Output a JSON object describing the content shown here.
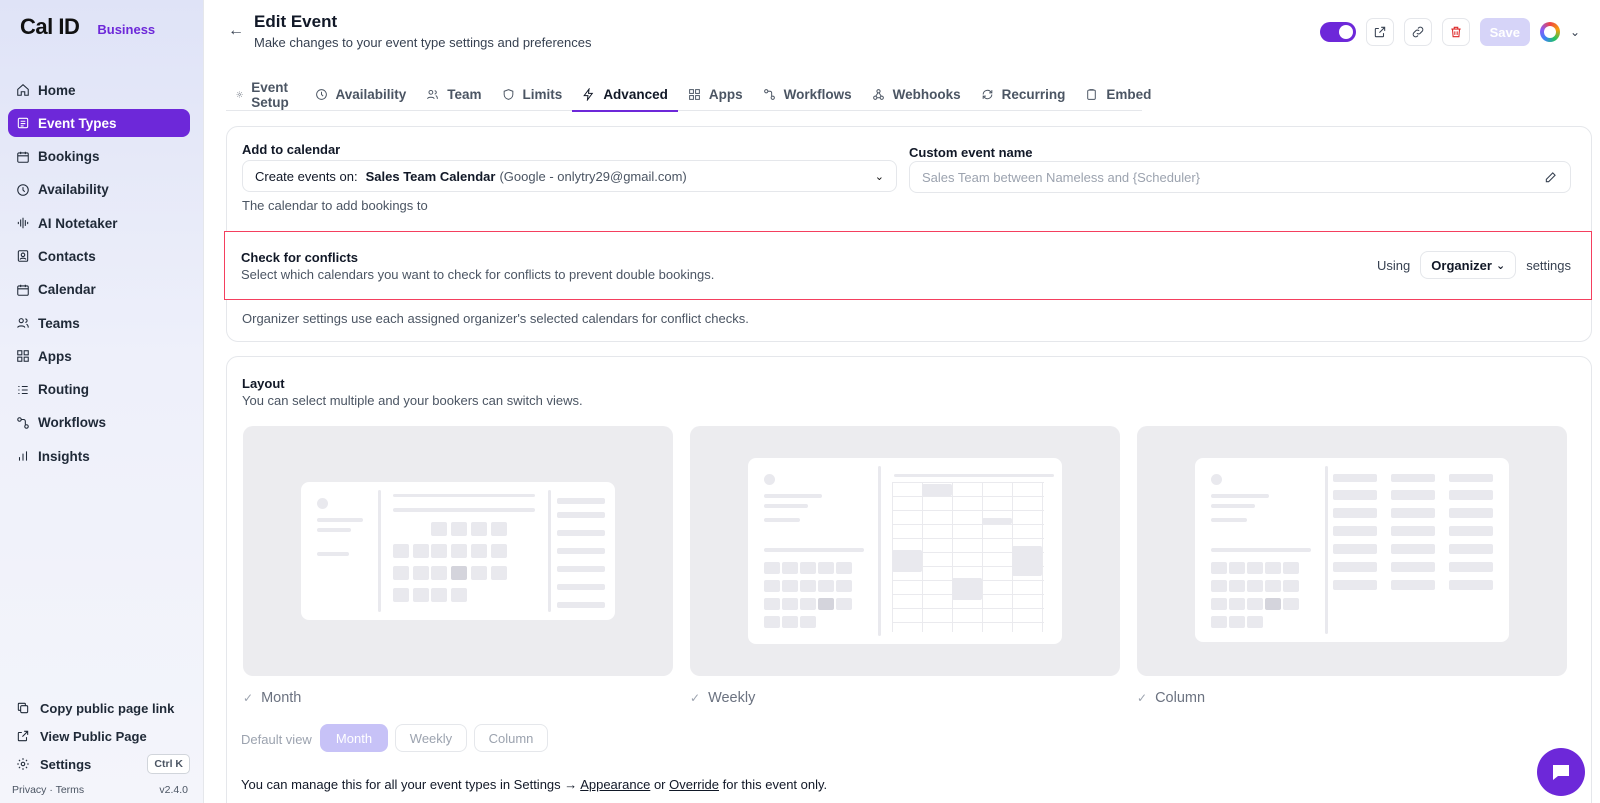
{
  "brand": {
    "logo": "Cal ID",
    "plan": "Business"
  },
  "sidebar": {
    "items": [
      {
        "label": "Home",
        "icon": "home-icon"
      },
      {
        "label": "Event Types",
        "icon": "link-icon"
      },
      {
        "label": "Bookings",
        "icon": "calendar-icon"
      },
      {
        "label": "Availability",
        "icon": "clock-icon"
      },
      {
        "label": "AI Notetaker",
        "icon": "waveform-icon"
      },
      {
        "label": "Contacts",
        "icon": "contact-icon"
      },
      {
        "label": "Calendar",
        "icon": "calendar-icon"
      },
      {
        "label": "Teams",
        "icon": "users-icon"
      },
      {
        "label": "Apps",
        "icon": "grid-icon"
      },
      {
        "label": "Routing",
        "icon": "list-icon"
      },
      {
        "label": "Workflows",
        "icon": "workflow-icon"
      },
      {
        "label": "Insights",
        "icon": "bar-chart-icon"
      }
    ],
    "active": "Event Types",
    "bottom": {
      "copy_link": "Copy public page link",
      "view_public": "View Public Page",
      "settings": "Settings",
      "shortcut": "Ctrl K"
    },
    "footer": {
      "privacy_terms": "Privacy · Terms",
      "version": "v2.4.0"
    }
  },
  "header": {
    "title": "Edit Event",
    "subtitle": "Make changes to your event type settings and preferences",
    "save": "Save"
  },
  "tabs": [
    "Event Setup",
    "Availability",
    "Team",
    "Limits",
    "Advanced",
    "Apps",
    "Workflows",
    "Webhooks",
    "Recurring",
    "Embed"
  ],
  "active_tab": "Advanced",
  "calendar": {
    "label": "Add to calendar",
    "select_prefix": "Create events on:",
    "select_value": "Sales Team Calendar",
    "select_detail": "(Google - onlytry29@gmail.com)",
    "help": "The calendar to add bookings to",
    "custom_name_label": "Custom event name",
    "custom_name_placeholder": "Sales Team between Nameless and {Scheduler}"
  },
  "conflicts": {
    "title": "Check for conflicts",
    "description": "Select which calendars you want to check for conflicts to prevent double bookings.",
    "using": "Using",
    "organizer": "Organizer",
    "settings": "settings",
    "note": "Organizer settings use each assigned organizer's selected calendars for conflict checks."
  },
  "layout": {
    "title": "Layout",
    "description": "You can select multiple and your bookers can switch views.",
    "options": [
      "Month",
      "Weekly",
      "Column"
    ],
    "default_view_label": "Default view",
    "default_view": "Month",
    "manage_prefix": "You can manage this for all your event types in Settings →",
    "appearance_link": "Appearance",
    "or": "or",
    "override_link": "Override",
    "manage_suffix": "for this event only."
  },
  "colors": {
    "accent": "#6d28d9",
    "danger": "#dc2626",
    "highlight": "#f43f5e"
  }
}
